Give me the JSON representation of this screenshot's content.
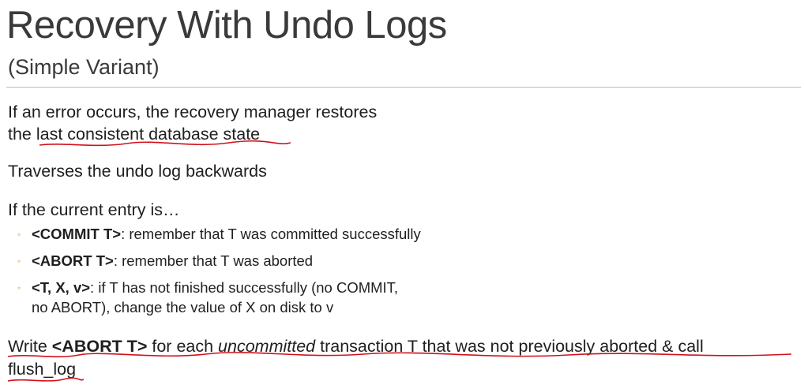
{
  "slide": {
    "title": "Recovery With Undo Logs",
    "subtitle": "(Simple Variant)",
    "p1_line1": "If an error occurs, the recovery manager restores",
    "p1_line2_prefix": "the ",
    "p1_line2_highlight": "last consistent database state",
    "p2": "Traverses the undo log backwards",
    "p3": "If the current entry is…",
    "bullets": [
      {
        "bold": "<COMMIT T>",
        "rest": ": remember that T was committed successfully"
      },
      {
        "bold": "<ABORT T>",
        "rest": ": remember that T was aborted"
      },
      {
        "bold": "<T, X, v>",
        "rest": ": if T has not finished successfully (no COMMIT,",
        "rest_line2": "no ABORT), change the value of X on disk to v"
      }
    ],
    "p4_part1": "Write ",
    "p4_bold": "<ABORT T>",
    "p4_part2": " for each ",
    "p4_italic": "uncommitted",
    "p4_part3": " transaction T that was not previously aborted & call",
    "p4_line2": "flush_log"
  },
  "colors": {
    "text": "#1f1f1f",
    "title": "#3a3a3a",
    "bullet": "#d68a2e",
    "annotation": "#d0101a"
  }
}
